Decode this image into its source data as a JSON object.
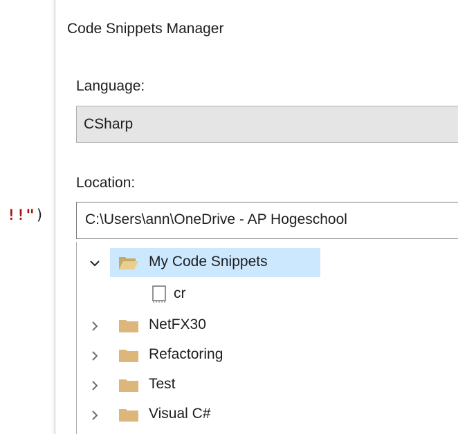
{
  "background_code": {
    "string_fragment": "!!\"",
    "paren": ")"
  },
  "dialog": {
    "title": "Code Snippets Manager",
    "language": {
      "label": "Language:",
      "value": "CSharp"
    },
    "location": {
      "label": "Location:",
      "value": "C:\\Users\\ann\\OneDrive - AP Hogeschool"
    },
    "tree": {
      "items": [
        {
          "label": "My Code Snippets",
          "icon": "folder-open-icon",
          "expanded": true,
          "selected": true
        },
        {
          "label": "cr",
          "icon": "file-icon",
          "child": true
        },
        {
          "label": "NetFX30",
          "icon": "folder-icon",
          "expanded": false
        },
        {
          "label": "Refactoring",
          "icon": "folder-icon",
          "expanded": false
        },
        {
          "label": "Test",
          "icon": "folder-icon",
          "expanded": false
        },
        {
          "label": "Visual C#",
          "icon": "folder-icon",
          "expanded": false
        }
      ]
    }
  },
  "colors": {
    "selection": "#cce8ff",
    "folder": "#dcb67a",
    "string": "#a31515"
  }
}
